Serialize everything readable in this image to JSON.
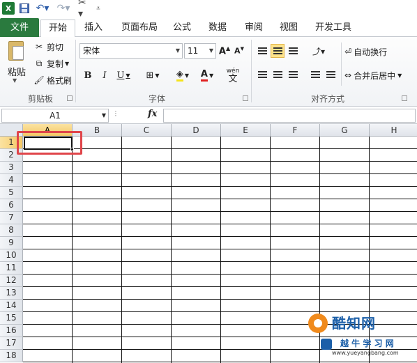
{
  "qat": {
    "logo": "X",
    "save_icon": "save-icon",
    "undo_icon": "undo-icon",
    "redo_icon": "redo-icon"
  },
  "tabs": [
    "文件",
    "开始",
    "插入",
    "页面布局",
    "公式",
    "数据",
    "审阅",
    "视图",
    "开发工具"
  ],
  "clipboard": {
    "paste": "粘贴",
    "cut": "剪切",
    "copy": "复制",
    "format_painter": "格式刷",
    "label": "剪贴板"
  },
  "font": {
    "name": "宋体",
    "size": "11",
    "label": "字体",
    "bold": "B",
    "italic": "I",
    "underline": "U",
    "color_letter": "A",
    "wen": "wén"
  },
  "alignment": {
    "wrap_text": "自动换行",
    "merge_center": "合并后居中",
    "label": "对齐方式"
  },
  "formula_bar": {
    "name_box": "A1",
    "fx": "fx",
    "value": ""
  },
  "grid": {
    "columns": [
      "A",
      "B",
      "C",
      "D",
      "E",
      "F",
      "G",
      "H"
    ],
    "rows": [
      "1",
      "2",
      "3",
      "4",
      "5",
      "6",
      "7",
      "8",
      "9",
      "10",
      "11",
      "12",
      "13",
      "14",
      "15",
      "16",
      "17",
      "18"
    ],
    "active_cell": "A1"
  },
  "watermark": {
    "brand": "酷知网",
    "sub": "越 牛 学 习 网",
    "url": "www.yueyangbang.com"
  },
  "colors": {
    "file_tab": "#2a7a3e",
    "highlight": "#e0454a",
    "selected_header": "#f4c866"
  }
}
